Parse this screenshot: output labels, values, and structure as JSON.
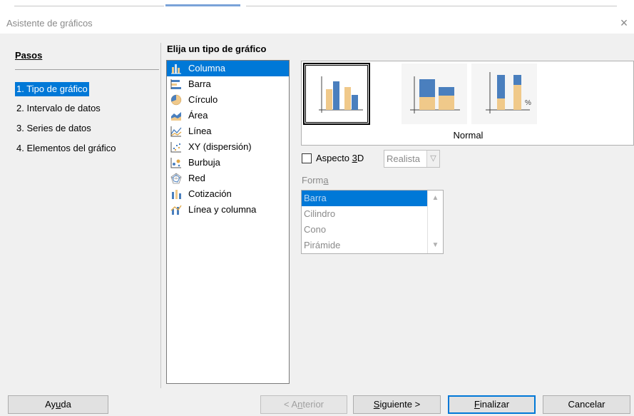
{
  "window": {
    "title": "Asistente de gráficos",
    "close_glyph": "×"
  },
  "steps": {
    "title": "Pasos",
    "items": [
      {
        "label": "1. Tipo de gráfico",
        "active": true
      },
      {
        "label": "2. Intervalo de datos",
        "active": false
      },
      {
        "label": "3. Series de datos",
        "active": false
      },
      {
        "label": "4. Elementos del gráfico",
        "active": false
      }
    ]
  },
  "chart_type": {
    "heading": "Elija un tipo de gráfico",
    "types": [
      {
        "label": "Columna",
        "icon": "column-chart-icon",
        "selected": true
      },
      {
        "label": "Barra",
        "icon": "bar-chart-icon",
        "selected": false
      },
      {
        "label": "Círculo",
        "icon": "pie-chart-icon",
        "selected": false
      },
      {
        "label": "Área",
        "icon": "area-chart-icon",
        "selected": false
      },
      {
        "label": "Línea",
        "icon": "line-chart-icon",
        "selected": false
      },
      {
        "label": "XY (dispersión)",
        "icon": "scatter-chart-icon",
        "selected": false
      },
      {
        "label": "Burbuja",
        "icon": "bubble-chart-icon",
        "selected": false
      },
      {
        "label": "Red",
        "icon": "net-chart-icon",
        "selected": false
      },
      {
        "label": "Cotización",
        "icon": "stock-chart-icon",
        "selected": false
      },
      {
        "label": "Línea y columna",
        "icon": "line-column-chart-icon",
        "selected": false
      }
    ]
  },
  "variants": {
    "selected_label": "Normal",
    "items": [
      {
        "name": "normal",
        "selected": true
      },
      {
        "name": "stacked",
        "selected": false
      },
      {
        "name": "percent-stacked",
        "selected": false,
        "badge": "%"
      }
    ]
  },
  "aspect3d": {
    "label_pre": "Aspecto ",
    "label_key": "3",
    "label_post": "D",
    "checked": false,
    "combo_value": "Realista"
  },
  "forma": {
    "label_pre": "Form",
    "label_key": "a",
    "items": [
      {
        "label": "Barra",
        "selected": true
      },
      {
        "label": "Cilindro",
        "selected": false
      },
      {
        "label": "Cono",
        "selected": false
      },
      {
        "label": "Pirámide",
        "selected": false
      }
    ]
  },
  "buttons": {
    "help": {
      "pre": "Ay",
      "key": "u",
      "post": "da"
    },
    "back": {
      "pre": "< A",
      "key": "n",
      "post": "terior"
    },
    "next": {
      "pre": "",
      "key": "S",
      "post": "iguiente >"
    },
    "finish": {
      "pre": "",
      "key": "F",
      "post": "inalizar"
    },
    "cancel": {
      "label": "Cancelar"
    }
  },
  "colors": {
    "accent": "#0078d7",
    "series_blue": "#4a7fbe",
    "series_tan": "#f0c98a"
  }
}
